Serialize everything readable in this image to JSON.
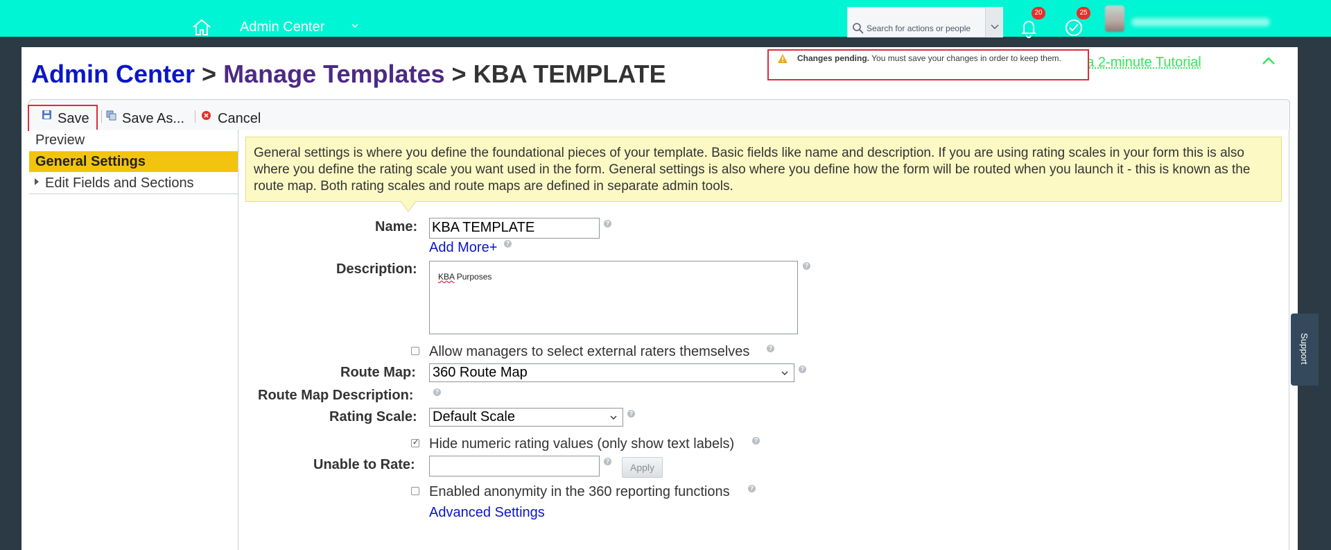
{
  "header": {
    "app_title": "Admin Center",
    "search_placeholder": "Search for actions or people",
    "notifications_count": "20",
    "approvals_count": "25",
    "colors": {
      "bar": "#00f5d4",
      "badge": "#e3302a"
    }
  },
  "breadcrumb": {
    "items": [
      "Admin Center",
      "Manage Templates",
      "KBA TEMPLATE"
    ],
    "separator": ">"
  },
  "notice": {
    "title": "Changes pending.",
    "message": "You must save your changes in order to keep them."
  },
  "tutorial_link": "tch a 2-minute Tutorial",
  "toolbar": {
    "save": "Save",
    "save_as": "Save As...",
    "cancel": "Cancel"
  },
  "nav": {
    "items": [
      "Preview",
      "General Settings",
      "Edit Fields and Sections"
    ],
    "active": "General Settings"
  },
  "info_text": "General settings is where you define the foundational pieces of your template. Basic fields like name and description. If you are using rating scales in your form this is also where you define the rating scale you want used in the form. General settings is also where you define how the form will be routed when you launch it - this is known as the route map. Both rating scales and route maps are defined in separate admin tools.",
  "form": {
    "name_label": "Name:",
    "name_value": "KBA TEMPLATE",
    "add_more": "Add More+",
    "description_label": "Description:",
    "description_value_word1": "KBA",
    "description_value_rest": " Purposes",
    "allow_external_raters": "Allow managers to select external raters themselves",
    "allow_external_raters_checked": false,
    "route_map_label": "Route Map:",
    "route_map_value": "360 Route Map",
    "route_map_desc_label": "Route Map Description:",
    "rating_scale_label": "Rating Scale:",
    "rating_scale_value": "Default Scale",
    "hide_numeric": "Hide numeric rating values (only show text labels)",
    "hide_numeric_checked": true,
    "unable_to_rate_label": "Unable to Rate:",
    "unable_to_rate_value": "",
    "apply": "Apply",
    "anonymity": "Enabled anonymity in the 360 reporting functions",
    "anonymity_checked": false,
    "advanced_settings": "Advanced Settings",
    "help_glyph": "?"
  },
  "support_tab": "Support"
}
